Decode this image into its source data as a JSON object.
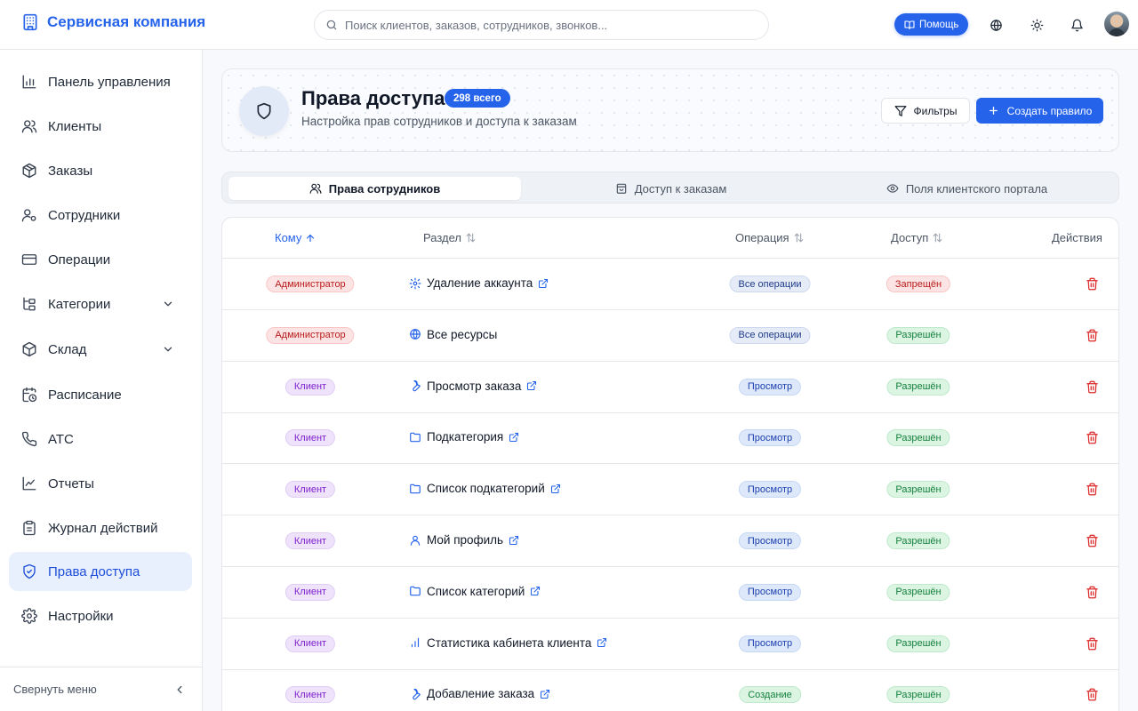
{
  "app": {
    "brand": "Сервисная компания",
    "search_placeholder": "Поиск клиентов, заказов, сотрудников, звонков...",
    "help_label": "Помощь"
  },
  "sidebar": {
    "items": [
      {
        "label": "Панель управления",
        "icon": "bar-chart-icon"
      },
      {
        "label": "Клиенты",
        "icon": "users-icon"
      },
      {
        "label": "Заказы",
        "icon": "package-icon"
      },
      {
        "label": "Сотрудники",
        "icon": "user-cog-icon"
      },
      {
        "label": "Операции",
        "icon": "credit-card-icon"
      },
      {
        "label": "Категории",
        "icon": "tree-icon"
      },
      {
        "label": "Склад",
        "icon": "box-icon"
      },
      {
        "label": "Расписание",
        "icon": "calendar-clock-icon"
      },
      {
        "label": "АТС",
        "icon": "phone-icon"
      },
      {
        "label": "Отчеты",
        "icon": "line-chart-icon"
      },
      {
        "label": "Журнал действий",
        "icon": "clipboard-icon"
      },
      {
        "label": "Права доступа",
        "icon": "shield-check-icon"
      },
      {
        "label": "Настройки",
        "icon": "settings-icon"
      }
    ],
    "collapse_label": "Свернуть меню"
  },
  "header": {
    "title": "Права доступа",
    "count_badge": "298 всего",
    "subtitle": "Настройка прав сотрудников и доступа к заказам",
    "filters_label": "Фильтры",
    "create_label": "Создать правило"
  },
  "tabs": [
    {
      "label": "Права сотрудников"
    },
    {
      "label": "Доступ к заказам"
    },
    {
      "label": "Поля клиентского портала"
    }
  ],
  "table": {
    "columns": {
      "who": "Кому",
      "section": "Раздел",
      "operation": "Операция",
      "access": "Доступ",
      "actions": "Действия"
    },
    "rows": [
      {
        "who": "Администратор",
        "section": "Удаление аккаунта",
        "icon": "gear-icon",
        "operation": "Все операции",
        "access": "Запрещён"
      },
      {
        "who": "Администратор",
        "section": "Все ресурсы",
        "icon": "globe-icon",
        "operation": "Все операции",
        "access": "Разрешён"
      },
      {
        "who": "Клиент",
        "section": "Просмотр заказа",
        "icon": "wrench-icon",
        "operation": "Просмотр",
        "access": "Разрешён"
      },
      {
        "who": "Клиент",
        "section": "Подкатегория",
        "icon": "folder-icon",
        "operation": "Просмотр",
        "access": "Разрешён"
      },
      {
        "who": "Клиент",
        "section": "Список подкатегорий",
        "icon": "folder-icon",
        "operation": "Просмотр",
        "access": "Разрешён"
      },
      {
        "who": "Клиент",
        "section": "Мой профиль",
        "icon": "user-icon",
        "operation": "Просмотр",
        "access": "Разрешён"
      },
      {
        "who": "Клиент",
        "section": "Список категорий",
        "icon": "folder-icon",
        "operation": "Просмотр",
        "access": "Разрешён"
      },
      {
        "who": "Клиент",
        "section": "Статистика кабинета клиента",
        "icon": "bar-chart-icon",
        "operation": "Просмотр",
        "access": "Разрешён"
      },
      {
        "who": "Клиент",
        "section": "Добавление заказа",
        "icon": "wrench-icon",
        "operation": "Создание",
        "access": "Разрешён"
      }
    ]
  },
  "colors": {
    "accent": "#2563eb",
    "danger": "#dc2626",
    "success": "#15803d"
  }
}
